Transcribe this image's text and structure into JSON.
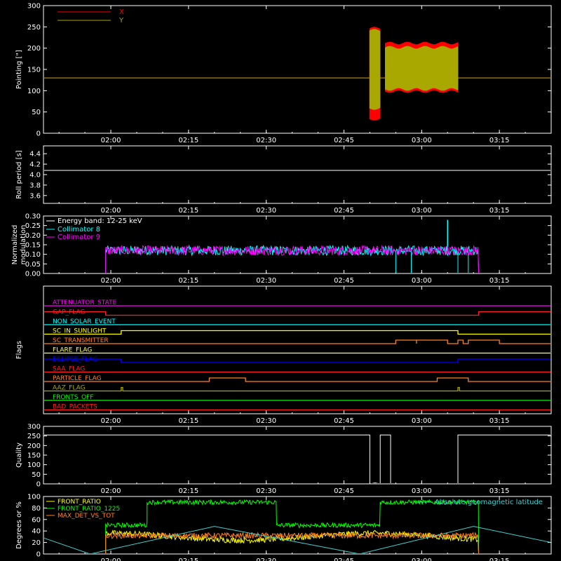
{
  "chart_data": [
    {
      "panel": "pointing",
      "type": "line",
      "ylabel": "Pointing [\"]",
      "ylim": [
        0,
        300
      ],
      "yticks": [
        "0",
        "50",
        "100",
        "150",
        "200",
        "250",
        "300"
      ],
      "xlim": [
        "01:47",
        "03:25"
      ],
      "xticks": [
        "02:00",
        "02:15",
        "02:30",
        "02:45",
        "03:00",
        "03:15"
      ],
      "legend": "top-left",
      "series": [
        {
          "name": "X",
          "color": "#ff0000",
          "baseline": 130,
          "bursts": [
            [
              "02:50",
              "02:52",
              30,
              250
            ],
            [
              "02:53",
              "03:07",
              95,
              215
            ]
          ]
        },
        {
          "name": "Y",
          "color": "#a8a800",
          "baseline": 130,
          "bursts": [
            [
              "02:50",
              "02:52",
              55,
              245
            ],
            [
              "02:53",
              "03:07",
              100,
              205
            ]
          ]
        }
      ]
    },
    {
      "panel": "roll",
      "type": "line",
      "ylabel": "Roll period [s]",
      "ylim": [
        3.45,
        4.55
      ],
      "yticks": [
        "3.6",
        "3.8",
        "4.0",
        "4.2",
        "4.4"
      ],
      "xticks": [
        "02:00",
        "02:15",
        "02:30",
        "02:45",
        "03:00",
        "03:15"
      ],
      "series": [
        {
          "color": "#ffffff",
          "value": 4.08
        }
      ]
    },
    {
      "panel": "modulation",
      "type": "line",
      "ylabel": "Normalized modulation",
      "ylim": [
        0,
        0.3
      ],
      "yticks": [
        "0.00",
        "0.05",
        "0.10",
        "0.15",
        "0.20",
        "0.25",
        "0.30"
      ],
      "xticks": [
        "02:00",
        "02:15",
        "02:30",
        "02:45",
        "03:00",
        "03:15"
      ],
      "annotation": "Energy band: 12-25 keV",
      "legend": "top-left",
      "series": [
        {
          "name": "Collimator 8",
          "color": "#00ffff",
          "start": "01:59",
          "end": "03:11",
          "level": 0.12,
          "spikes": [
            [
              "03:05",
              0.28
            ]
          ],
          "dropouts": [
            "02:55",
            "02:58",
            "03:07",
            "03:09"
          ]
        },
        {
          "name": "Collimator 9",
          "color": "#ff00ff",
          "start": "01:59",
          "end": "03:11",
          "level": 0.12
        }
      ]
    },
    {
      "panel": "flags",
      "type": "line",
      "ylabel": "Flags",
      "xticks": [
        "02:00",
        "02:15",
        "02:30",
        "02:45",
        "03:00",
        "03:15"
      ],
      "flags": [
        {
          "name": "ATTENUATOR_STATE",
          "color": "#ff00ff",
          "segments": []
        },
        {
          "name": "GAP_FLAG",
          "color": "#ff2020",
          "segments": [
            [
              "01:47",
              "01:59"
            ],
            [
              "03:11",
              "03:25"
            ]
          ]
        },
        {
          "name": "NON_SOLAR_EVENT",
          "color": "#00ffff",
          "segments": []
        },
        {
          "name": "SC_IN_SUNLIGHT",
          "color": "#ffff00",
          "segments": [
            [
              "02:02",
              "03:07"
            ]
          ]
        },
        {
          "name": "SC_TRANSMITTER",
          "color": "#ff8020",
          "segments": [
            [
              "02:55",
              "02:59"
            ],
            [
              "02:59",
              "03:05"
            ],
            [
              "03:07",
              "03:08"
            ],
            [
              "03:09",
              "03:15"
            ]
          ]
        },
        {
          "name": "FLARE_FLAG",
          "color": "#ffff60",
          "segments": []
        },
        {
          "name": "ECLIPSE_FLAG",
          "color": "#0000ff",
          "segments": [
            [
              "01:47",
              "02:02"
            ],
            [
              "03:07",
              "03:25"
            ]
          ]
        },
        {
          "name": "SAA_FLAG",
          "color": "#ff2020",
          "segments": []
        },
        {
          "name": "PARTICLE_FLAG",
          "color": "#ff8020",
          "segments": [
            [
              "02:19",
              "02:26"
            ],
            [
              "03:03",
              "03:09"
            ]
          ]
        },
        {
          "name": "AAZ_FLAG",
          "color": "#a8a800",
          "segments": [
            [
              "02:02",
              "02:02.3"
            ],
            [
              "03:07",
              "03:07.3"
            ]
          ]
        },
        {
          "name": "FRONTS_OFF",
          "color": "#00ff00",
          "segments": []
        },
        {
          "name": "BAD_PACKETS",
          "color": "#ff2020",
          "segments": []
        }
      ]
    },
    {
      "panel": "quality",
      "type": "line",
      "ylabel": "Quality",
      "ylim": [
        0,
        300
      ],
      "yticks": [
        "0",
        "50",
        "100",
        "150",
        "200",
        "250",
        "300"
      ],
      "xticks": [
        "02:00",
        "02:15",
        "02:30",
        "02:45",
        "03:00",
        "03:15"
      ],
      "series": [
        {
          "color": "#ffffff",
          "points": [
            [
              "01:47",
              255
            ],
            [
              "02:50",
              255
            ],
            [
              "02:50",
              0
            ],
            [
              "02:51",
              5
            ],
            [
              "02:52",
              0
            ],
            [
              "02:52",
              255
            ],
            [
              "02:54",
              255
            ],
            [
              "02:54",
              0
            ],
            [
              "03:07",
              0
            ],
            [
              "03:07",
              255
            ],
            [
              "03:25",
              255
            ]
          ]
        }
      ]
    },
    {
      "panel": "ratios",
      "type": "line",
      "ylabel": "Degrees or %",
      "ylim": [
        0,
        100
      ],
      "yticks": [
        "0",
        "20",
        "40",
        "60",
        "80",
        "100"
      ],
      "xticks": [
        "02:00",
        "02:15",
        "02:30",
        "02:45",
        "03:00",
        "03:15"
      ],
      "legend": "top-left",
      "series": [
        {
          "name": "FRONT_RATIO",
          "color": "#ffff00",
          "segments": [
            [
              "01:59",
              "03:11",
              30
            ]
          ]
        },
        {
          "name": "FRONT_RATIO_1225",
          "color": "#00ff00",
          "segments": [
            [
              "01:59",
              "02:07",
              50
            ],
            [
              "02:07",
              "02:32",
              90
            ],
            [
              "02:32",
              "02:52",
              50
            ],
            [
              "02:52",
              "03:11",
              90
            ]
          ]
        },
        {
          "name": "MAX_DET_VS_TOT",
          "color": "#ff8020",
          "segments": [
            [
              "01:59",
              "03:11",
              32
            ]
          ]
        },
        {
          "name": "Absolute geomagnetic latitude",
          "color": "#40d0d0",
          "points": [
            [
              "01:47",
              28
            ],
            [
              "01:56",
              0
            ],
            [
              "02:20",
              48
            ],
            [
              "02:48",
              0
            ],
            [
              "03:10",
              48
            ],
            [
              "03:25",
              20
            ]
          ]
        }
      ]
    }
  ]
}
